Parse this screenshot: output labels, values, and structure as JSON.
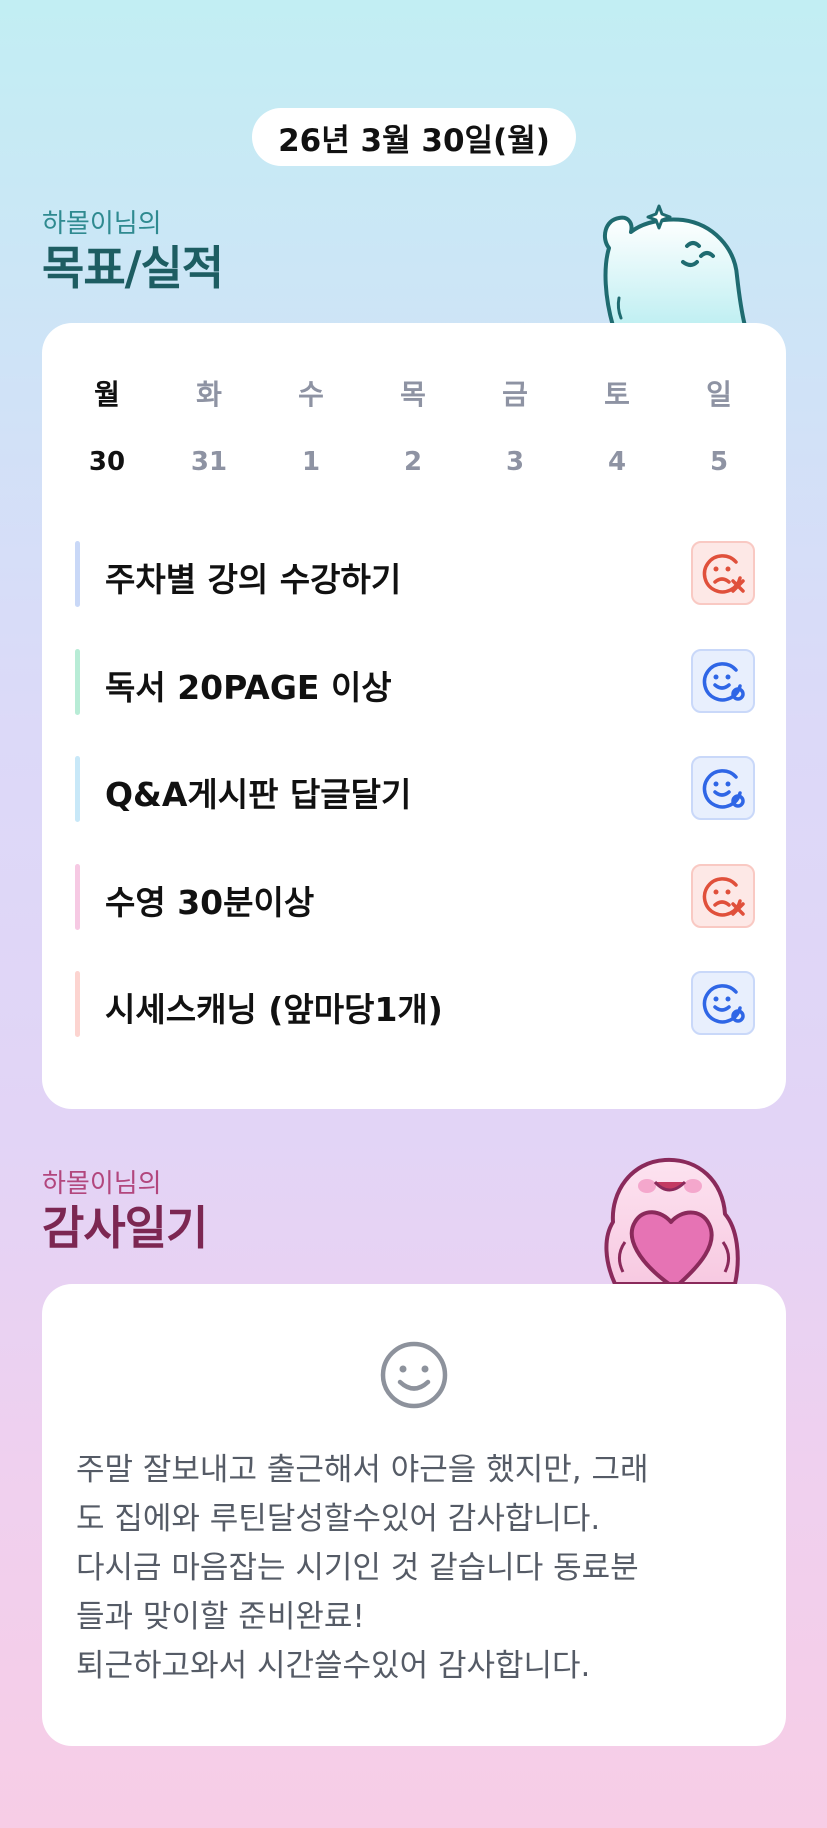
{
  "header": {
    "date": "26년 3월 30일(월)"
  },
  "goals_section": {
    "subtitle": "하몰이님의",
    "title": "목표/실적",
    "week": [
      {
        "day": "월",
        "date": "30",
        "active": true
      },
      {
        "day": "화",
        "date": "31",
        "active": false
      },
      {
        "day": "수",
        "date": "1",
        "active": false
      },
      {
        "day": "목",
        "date": "2",
        "active": false
      },
      {
        "day": "금",
        "date": "3",
        "active": false
      },
      {
        "day": "토",
        "date": "4",
        "active": false
      },
      {
        "day": "일",
        "date": "5",
        "active": false
      }
    ],
    "goals": [
      {
        "text": "주차별 강의 수강하기",
        "status": "fail",
        "accent": "#c9d8f7",
        "icon": "sad-face-x-icon"
      },
      {
        "text": "독서 20PAGE 이상",
        "status": "success",
        "accent": "#b8ecd6",
        "icon": "smile-face-o-icon"
      },
      {
        "text": "Q&A게시판 답글달기",
        "status": "success",
        "accent": "#c8e8f8",
        "icon": "smile-face-o-icon"
      },
      {
        "text": "수영 30분이상",
        "status": "fail",
        "accent": "#f6c9e3",
        "icon": "sad-face-x-icon"
      },
      {
        "text": "시세스캐닝 (앞마당1개)",
        "status": "success",
        "accent": "#fcd4d0",
        "icon": "smile-face-o-icon"
      }
    ]
  },
  "gratitude_section": {
    "subtitle": "하몰이님의",
    "title": "감사일기",
    "mood_icon": "smile-icon",
    "lines": [
      "주말 잘보내고 출근해서 야근을 했지만, 그래",
      "도 집에와 루틴달성할수있어 감사합니다.",
      "다시금 마음잡는 시기인 것 같습니다 동료분",
      "들과 맞이할 준비완료!",
      "퇴근하고와서 시간쓸수있어 감사합니다."
    ]
  },
  "colors": {
    "fail": "#e0503b",
    "success": "#2f66e6",
    "goal_title": "#1d5d62",
    "gratitude_title": "#7c2752"
  }
}
